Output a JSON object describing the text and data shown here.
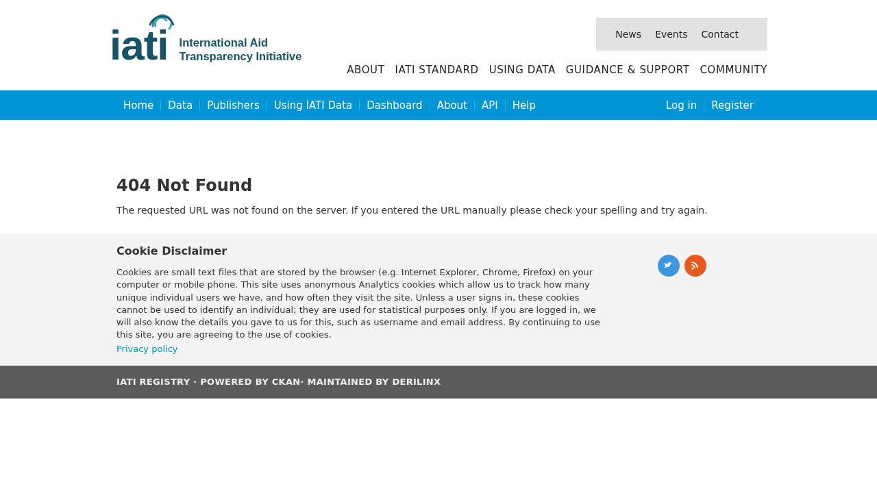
{
  "logo": {
    "mark": "iati",
    "line_1": "International Aid",
    "line_2": "Transparency Initiative"
  },
  "utility_nav": [
    "News",
    "Events",
    "Contact"
  ],
  "main_nav": [
    "ABOUT",
    "IATI STANDARD",
    "USING DATA",
    "GUIDANCE & SUPPORT",
    "COMMUNITY"
  ],
  "registry_nav": {
    "left": [
      "Home",
      "Data",
      "Publishers",
      "Using IATI Data",
      "Dashboard",
      "About",
      "API",
      "Help"
    ],
    "right": [
      "Log in",
      "Register"
    ]
  },
  "error": {
    "title": "404 Not Found",
    "message": "The requested URL was not found on the server. If you entered the URL manually please check your spelling and try again."
  },
  "cookie": {
    "title": "Cookie Disclaimer",
    "text": "Cookies are small text files that are stored by the browser (e.g. Internet Explorer, Chrome, Firefox) on your computer or mobile phone. This site uses anonymous Analytics cookies which allow us to track how many unique individual users we have, and how often they visit the site. Unless a user signs in, these cookies cannot be used to identify an individual; they are used for statistical purposes only. If you are logged in, we will also know the details you gave to us for this, such as username and email address. By continuing to use this site, you are agreeing to the use of cookies.",
    "link": "Privacy policy"
  },
  "social": [
    {
      "kind": "twitter",
      "color": "#3d97e0"
    },
    {
      "kind": "rss",
      "color": "#e8591e"
    }
  ],
  "footer": "IATI REGISTRY · POWERED BY CKAN· MAINTAINED BY DERILINX"
}
